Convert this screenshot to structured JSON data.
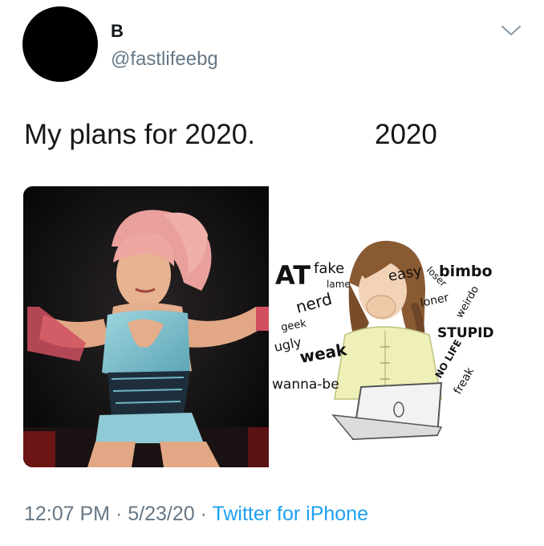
{
  "author": {
    "display_name": "B",
    "handle": "@fastlifeebg"
  },
  "tweet": {
    "text_left": "My plans for 2020.",
    "text_right": "2020"
  },
  "illustration_words": {
    "w1": "AT",
    "w2": "fake",
    "w3": "lame",
    "w4": "nerd",
    "w5": "geek",
    "w6": "ugly",
    "w7": "weak",
    "w8": "wanna-be",
    "w9": "easy",
    "w10": "loser",
    "w11": "bimbo",
    "w12": "loner",
    "w13": "weirdo",
    "w14": "STUPID",
    "w15": "NO LIFE",
    "w16": "freak"
  },
  "meta": {
    "time": "12:07 PM",
    "sep1": "·",
    "date": "5/23/20",
    "sep2": "·",
    "source": "Twitter for iPhone"
  },
  "colors": {
    "text": "#14171a",
    "secondary": "#657786",
    "link": "#1da1f2"
  }
}
